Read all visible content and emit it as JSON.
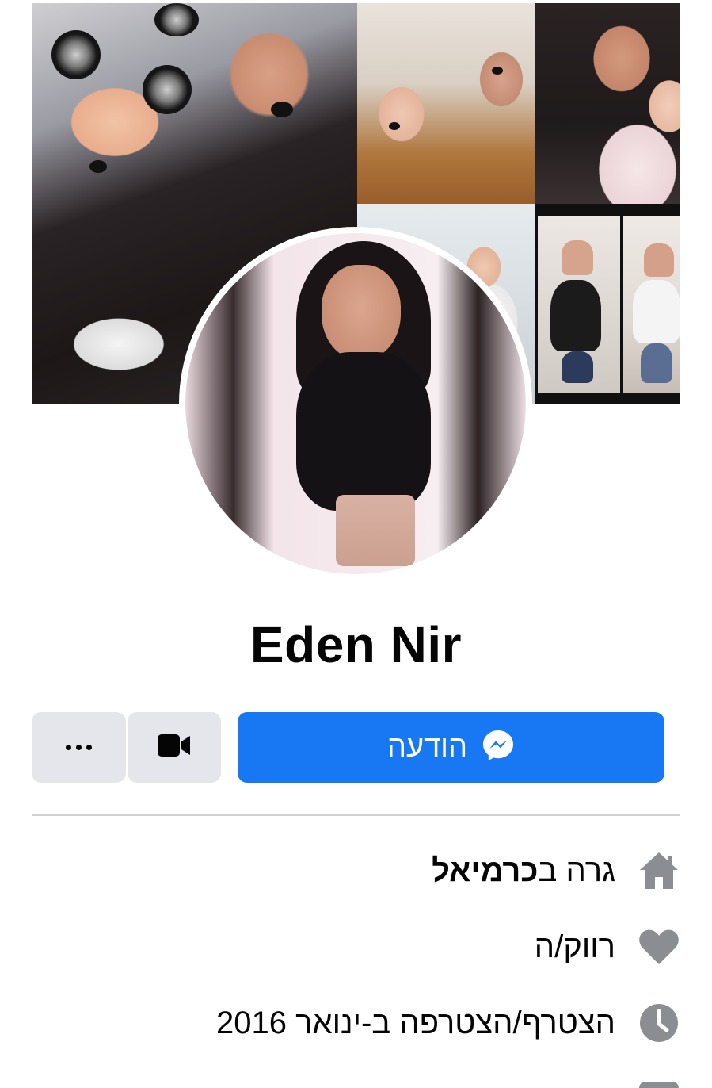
{
  "profile": {
    "name": "Eden Nir"
  },
  "actions": {
    "message_label": "הודעה",
    "video_icon": "video-camera-icon",
    "more_icon": "more-dots-icon",
    "message_icon": "messenger-icon"
  },
  "intro": {
    "lives_in_prefix": "גרה ב",
    "lives_in_place": "כרמיאל",
    "lives_in_icon": "home-icon",
    "relationship": "רווק/ה",
    "relationship_icon": "heart-icon",
    "joined": "הצטרף/הצטרפה ב-ינואר 2016",
    "joined_icon": "clock-icon"
  },
  "colors": {
    "primary": "#1877f2",
    "button_secondary": "#e4e6eb",
    "icon_gray": "#8a8d91",
    "text": "#050505",
    "divider": "#ced0d4"
  }
}
